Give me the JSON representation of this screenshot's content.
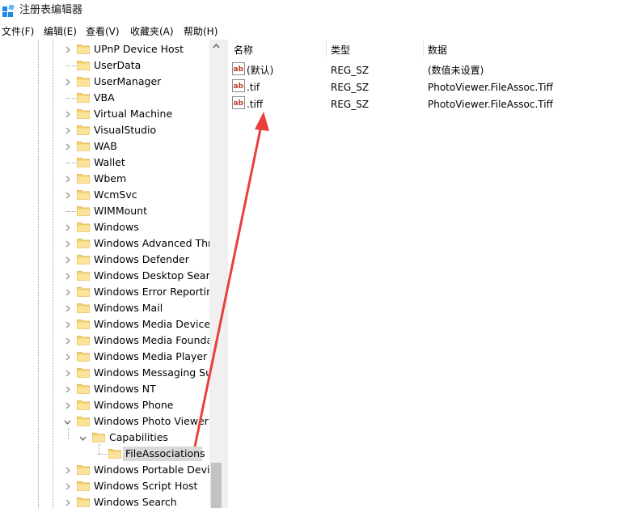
{
  "window": {
    "title": "注册表编辑器"
  },
  "menu": [
    "文件(F)",
    "编辑(E)",
    "查看(V)",
    "收藏夹(A)",
    "帮助(H)"
  ],
  "tree": {
    "items": [
      {
        "label": "UPnP Device Host",
        "expander": "collapsed",
        "level": 0
      },
      {
        "label": "UserData",
        "expander": "none",
        "level": 0
      },
      {
        "label": "UserManager",
        "expander": "collapsed",
        "level": 0
      },
      {
        "label": "VBA",
        "expander": "none",
        "level": 0
      },
      {
        "label": "Virtual Machine",
        "expander": "collapsed",
        "level": 0
      },
      {
        "label": "VisualStudio",
        "expander": "collapsed",
        "level": 0
      },
      {
        "label": "WAB",
        "expander": "collapsed",
        "level": 0
      },
      {
        "label": "Wallet",
        "expander": "none",
        "level": 0
      },
      {
        "label": "Wbem",
        "expander": "collapsed",
        "level": 0
      },
      {
        "label": "WcmSvc",
        "expander": "collapsed",
        "level": 0
      },
      {
        "label": "WIMMount",
        "expander": "none",
        "level": 0
      },
      {
        "label": "Windows",
        "expander": "collapsed",
        "level": 0
      },
      {
        "label": "Windows Advanced Thre",
        "expander": "collapsed",
        "level": 0
      },
      {
        "label": "Windows Defender",
        "expander": "collapsed",
        "level": 0
      },
      {
        "label": "Windows Desktop Searc",
        "expander": "collapsed",
        "level": 0
      },
      {
        "label": "Windows Error Reportin",
        "expander": "collapsed",
        "level": 0
      },
      {
        "label": "Windows Mail",
        "expander": "collapsed",
        "level": 0
      },
      {
        "label": "Windows Media Device I",
        "expander": "collapsed",
        "level": 0
      },
      {
        "label": "Windows Media Founda",
        "expander": "collapsed",
        "level": 0
      },
      {
        "label": "Windows Media Player N",
        "expander": "collapsed",
        "level": 0
      },
      {
        "label": "Windows Messaging Sul",
        "expander": "collapsed",
        "level": 0
      },
      {
        "label": "Windows NT",
        "expander": "collapsed",
        "level": 0
      },
      {
        "label": "Windows Phone",
        "expander": "collapsed",
        "level": 0
      },
      {
        "label": "Windows Photo Viewer",
        "expander": "expanded",
        "level": 0
      },
      {
        "label": "Capabilities",
        "expander": "expanded",
        "level": 1
      },
      {
        "label": "FileAssociations",
        "expander": "none",
        "level": 2,
        "selected": true
      },
      {
        "label": "Windows Portable Devic",
        "expander": "collapsed",
        "level": 0
      },
      {
        "label": "Windows Script Host",
        "expander": "collapsed",
        "level": 0
      },
      {
        "label": "Windows Search",
        "expander": "collapsed",
        "level": 0
      }
    ]
  },
  "values": {
    "headers": {
      "name": "名称",
      "type": "类型",
      "data": "数据"
    },
    "rows": [
      {
        "name": "(默认)",
        "type": "REG_SZ",
        "data": "(数值未设置)"
      },
      {
        "name": ".tif",
        "type": "REG_SZ",
        "data": "PhotoViewer.FileAssoc.Tiff"
      },
      {
        "name": ".tiff",
        "type": "REG_SZ",
        "data": "PhotoViewer.FileAssoc.Tiff"
      }
    ]
  },
  "colors": {
    "folder": "#f6d26b",
    "folder_edge": "#d9a838",
    "annotation_arrow": "#e8403c",
    "value_icon": "#c0392b"
  },
  "icons": {
    "app": "registry-editor-icon",
    "folder": "folder-icon",
    "value": "string-value-ab-icon"
  }
}
